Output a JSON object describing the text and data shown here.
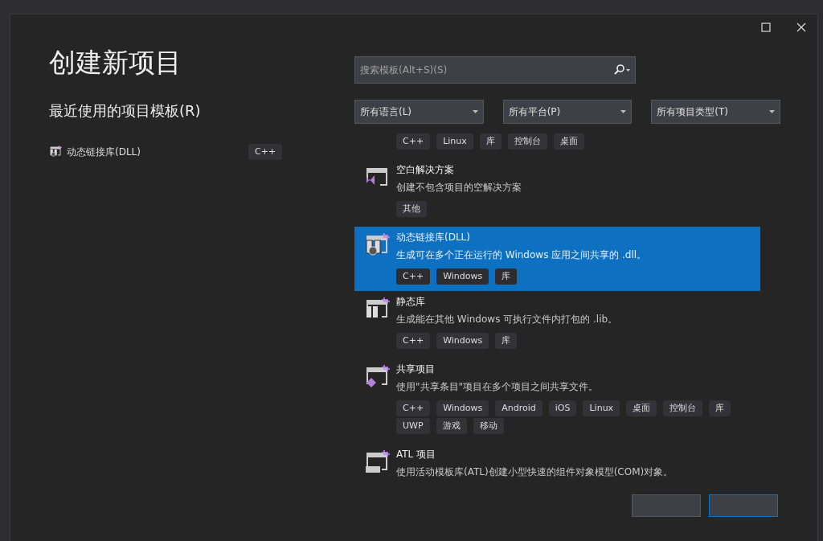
{
  "window": {
    "title": "创建新项目"
  },
  "recent": {
    "heading": "最近使用的项目模板(R)",
    "items": [
      {
        "name": "动态链接库(DLL)",
        "tag": "C++",
        "kind": "dll"
      }
    ]
  },
  "search": {
    "placeholder": "搜索模板(Alt+S)(S)"
  },
  "filters": [
    {
      "value": "所有语言(L)"
    },
    {
      "value": "所有平台(P)"
    },
    {
      "value": "所有项目类型(T)"
    }
  ],
  "templates": [
    {
      "kind": "partial",
      "selected": false,
      "tags": [
        "C++",
        "Linux",
        "库",
        "控制台",
        "桌面"
      ]
    },
    {
      "kind": "solution",
      "selected": false,
      "title": "空白解决方案",
      "description": "创建不包含项目的空解决方案",
      "tags": [
        "其他"
      ]
    },
    {
      "kind": "dll",
      "selected": true,
      "title": "动态链接库(DLL)",
      "description": "生成可在多个正在运行的 Windows 应用之间共享的 .dll。",
      "tags": [
        "C++",
        "Windows",
        "库"
      ]
    },
    {
      "kind": "static",
      "selected": false,
      "title": "静态库",
      "description": "生成能在其他 Windows 可执行文件内打包的 .lib。",
      "tags": [
        "C++",
        "Windows",
        "库"
      ]
    },
    {
      "kind": "shared",
      "selected": false,
      "title": "共享项目",
      "description": "使用\"共享条目\"项目在多个项目之间共享文件。",
      "tags": [
        "C++",
        "Windows",
        "Android",
        "iOS",
        "Linux",
        "桌面",
        "控制台",
        "库",
        "UWP",
        "游戏",
        "移动"
      ]
    },
    {
      "kind": "atl",
      "selected": false,
      "title": "ATL 项目",
      "description": "使用活动模板库(ATL)创建小型快速的组件对象模型(COM)对象。"
    }
  ],
  "footer_buttons": [
    {
      "kind": "plain"
    },
    {
      "kind": "primary"
    }
  ]
}
